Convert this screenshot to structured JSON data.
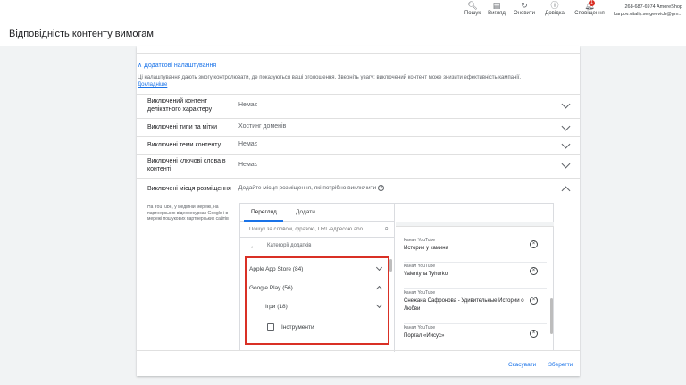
{
  "topbar": {
    "tools": [
      {
        "icon": "search-icon",
        "label": "Пошук"
      },
      {
        "icon": "view-icon",
        "label": "Вигляд"
      },
      {
        "icon": "refresh-icon",
        "label": "Оновити"
      },
      {
        "icon": "help-icon",
        "label": "Довідка"
      },
      {
        "icon": "bell-icon",
        "label": "Сповіщення",
        "badge": "1"
      }
    ],
    "account_id": "268-687-6974 AmoreShop",
    "account_email": "karpov.vitaliy.sergeevich@gm..."
  },
  "page": {
    "title": "Відповідність контенту вимогам"
  },
  "advanced": {
    "toggle_label": "Додаткові налаштування",
    "description": "Ці налаштування дають змогу контролювати, де показуються ваші оголошення. Зверніть увагу: виключений контент може знизити ефективність кампанії.",
    "more_link": "Докладніше"
  },
  "settings": [
    {
      "label": "Виключений контент делікатного характеру",
      "value": "Немає"
    },
    {
      "label": "Виключені типи та мітки",
      "value": "Хостинг доменів"
    },
    {
      "label": "Виключені теми контенту",
      "value": "Немає"
    },
    {
      "label": "Виключені ключові слова в контенті",
      "value": "Немає"
    }
  ],
  "excluded_placements": {
    "label": "Виключені місця розміщення",
    "sub": "На YouTube, у медійній мережі, на партнерських відеоресурсах Google і в мережі пошукових партнерських сайтів",
    "hint": "Додайте місця розміщення, які потрібно виключити",
    "tabs": [
      "Перегляд",
      "Додати"
    ],
    "search_placeholder": "Пошук за словом, фразою, URL-адресою або...",
    "category_label": "Категорії додатків",
    "tree": [
      {
        "label": "Apple App Store (84)"
      },
      {
        "label": "Google Play (56)"
      },
      {
        "label": "Ігри (18)"
      },
      {
        "label": "Інструменти"
      }
    ],
    "selected": [
      {
        "kind": "Канал YouTube",
        "name": "Истории у камина"
      },
      {
        "kind": "Канал YouTube",
        "name": "Valentyna Tyhurko"
      },
      {
        "kind": "Канал YouTube",
        "name": "Снежана Сафронова - Удивительные Истории о Любви"
      },
      {
        "kind": "Канал YouTube",
        "name": "Портал «Иисус»"
      }
    ]
  },
  "footer": {
    "cancel": "Скасувати",
    "save": "Зберегти"
  }
}
